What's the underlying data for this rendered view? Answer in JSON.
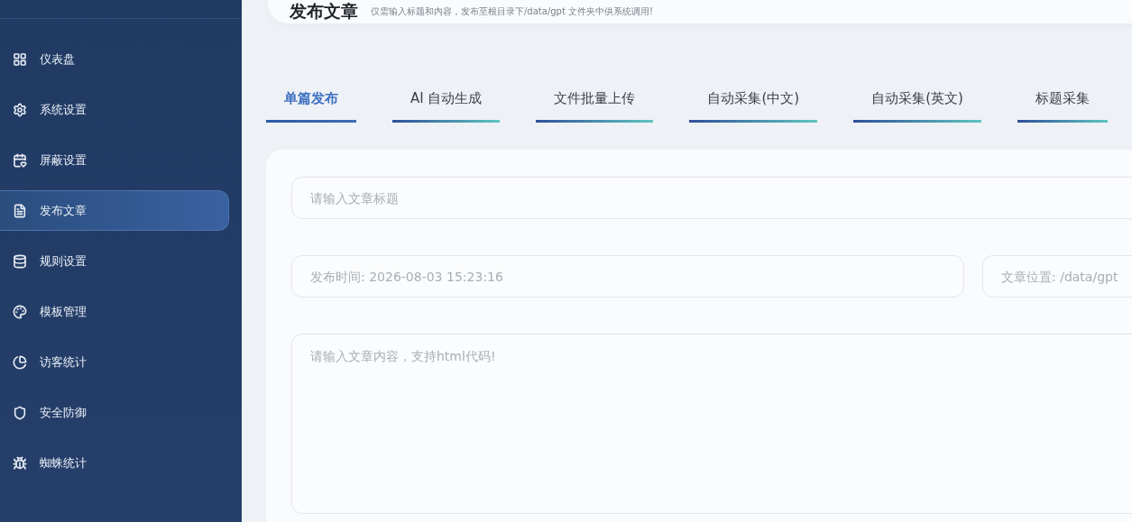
{
  "sidebar": {
    "items": [
      {
        "label": "仪表盘",
        "selected": false
      },
      {
        "label": "系统设置",
        "selected": false
      },
      {
        "label": "屏蔽设置",
        "selected": false
      },
      {
        "label": "发布文章",
        "selected": true
      },
      {
        "label": "规则设置",
        "selected": false
      },
      {
        "label": "模板管理",
        "selected": false
      },
      {
        "label": "访客统计",
        "selected": false
      },
      {
        "label": "安全防御",
        "selected": false
      },
      {
        "label": "蜘蛛统计",
        "selected": false
      }
    ]
  },
  "header": {
    "title": "发布文章",
    "subtitle": "仅需输入标题和内容，发布至根目录下/data/gpt 文件夹中供系统调用!"
  },
  "tabs": [
    {
      "label": "单篇发布",
      "selected": true
    },
    {
      "label": "AI 自动生成",
      "selected": false
    },
    {
      "label": "文件批量上传",
      "selected": false
    },
    {
      "label": "自动采集(中文)",
      "selected": false
    },
    {
      "label": "自动采集(英文)",
      "selected": false
    },
    {
      "label": "标题采集",
      "selected": false
    }
  ],
  "form": {
    "title_field": {
      "placeholder": "请输入文章标题"
    },
    "time_field": {
      "placeholder": "发布时间: 2026-08-03 15:23:16"
    },
    "location_field": {
      "placeholder": "文章位置: /data/gpt"
    },
    "content_field": {
      "placeholder": "请输入文章内容，支持html代码!"
    }
  }
}
